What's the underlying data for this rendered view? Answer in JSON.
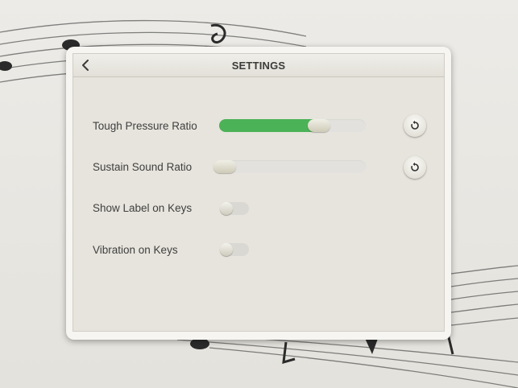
{
  "header": {
    "title": "SETTINGS",
    "back_icon": "chevron-left-icon"
  },
  "settings": {
    "touch_pressure": {
      "label": "Tough Pressure Ratio",
      "value_fraction": 0.68,
      "reset_icon": "reset-icon"
    },
    "sustain_sound": {
      "label": "Sustain Sound Ratio",
      "value_fraction": 0.0,
      "reset_icon": "reset-icon"
    },
    "show_label": {
      "label": "Show Label on Keys",
      "enabled": false
    },
    "vibration": {
      "label": "Vibration on Keys",
      "enabled": false
    }
  },
  "colors": {
    "accent_fill": "#4cb257",
    "panel_bg": "#e6e4dc"
  }
}
